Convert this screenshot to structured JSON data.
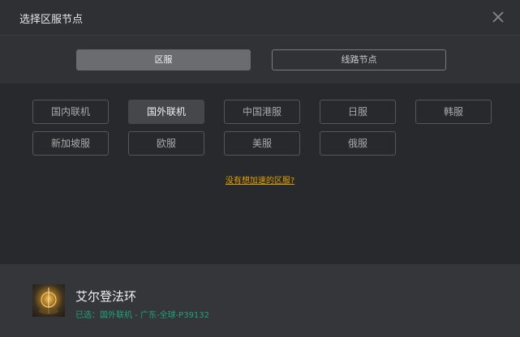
{
  "header": {
    "title": "选择区服节点",
    "close_icon": "close-icon"
  },
  "tabs": [
    {
      "label": "区服",
      "active": true
    },
    {
      "label": "线路节点",
      "active": false
    }
  ],
  "regions": [
    {
      "label": "国内联机",
      "selected": false
    },
    {
      "label": "国外联机",
      "selected": true
    },
    {
      "label": "中国港服",
      "selected": false
    },
    {
      "label": "日服",
      "selected": false
    },
    {
      "label": "韩服",
      "selected": false
    },
    {
      "label": "新加坡服",
      "selected": false
    },
    {
      "label": "欧服",
      "selected": false
    },
    {
      "label": "美服",
      "selected": false
    },
    {
      "label": "俄服",
      "selected": false
    }
  ],
  "help_link": "没有想加速的区服?",
  "footer": {
    "game_icon": "game-cover-icon",
    "game_name": "艾尔登法环",
    "selected_info": "已选：国外联机 - 广东-全球-P39132"
  },
  "colors": {
    "accent": "#e0a000",
    "selected_text": "#1fa37a"
  }
}
